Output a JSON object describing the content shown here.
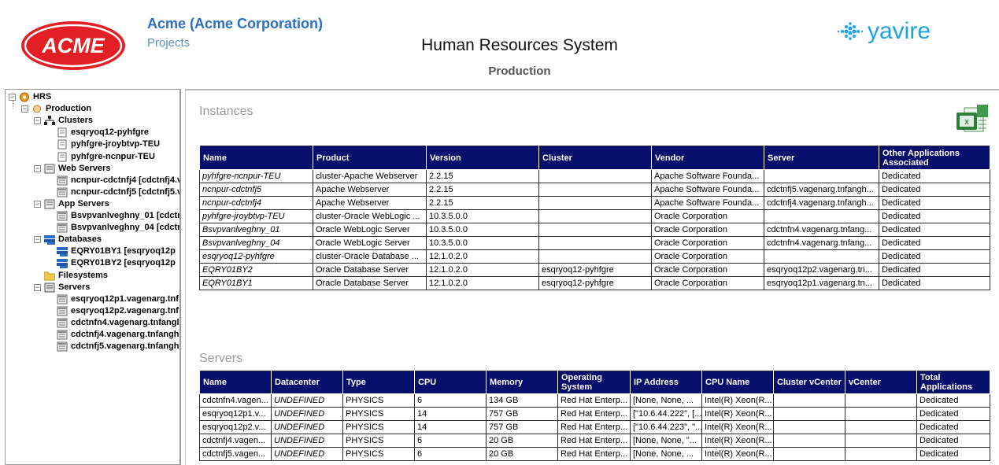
{
  "header": {
    "company": "Acme (Acme Corporation)",
    "projects_link": "Projects",
    "system_title": "Human Resources System",
    "environment": "Production",
    "acme_logo_text": "ACME",
    "yavire_logo_text": "yavire",
    "colors": {
      "acme_red": "#e31e24",
      "company_blue": "#2a6ec6",
      "yavire_blue": "#1aa3e8"
    }
  },
  "tree": {
    "root": "HRS",
    "environment": "Production",
    "groups": [
      {
        "label": "Clusters",
        "icon": "cluster-icon",
        "items": [
          "esqryoq12-pyhfgre",
          "pyhfgre-jroybtvp-TEU",
          "pyhfgre-ncnpur-TEU"
        ]
      },
      {
        "label": "Web Servers",
        "icon": "web-server-icon",
        "items": [
          "ncnpur-cdctnfj4 [cdctnfj4.v",
          "ncnpur-cdctnfj5 [cdctnfj5.v"
        ]
      },
      {
        "label": "App Servers",
        "icon": "app-server-icon",
        "items": [
          "Bsvpvanlveghny_01 [cdctn",
          "Bsvpvanlveghny_04 [cdctn"
        ]
      },
      {
        "label": "Databases",
        "icon": "database-icon",
        "items": [
          "EQRY01BY1 [esqryoq12p",
          "EQRY01BY2 [esqryoq12p"
        ]
      },
      {
        "label": "Filesystems",
        "icon": "folder-icon",
        "items": []
      },
      {
        "label": "Servers",
        "icon": "server-icon",
        "items": [
          "esqryoq12p1.vagenarg.tnf",
          "esqryoq12p2.vagenarg.tnf",
          "cdctnfn4.vagenarg.tnfangl",
          "cdctnfj4.vagenarg.tnfangh",
          "cdctnfj5.vagenarg.tnfangh"
        ]
      }
    ]
  },
  "instances": {
    "title": "Instances",
    "columns": [
      "Name",
      "Product",
      "Version",
      "Cluster",
      "Vendor",
      "Server",
      "Other Applications Associated"
    ],
    "rows": [
      [
        "pyhfgre-ncnpur-TEU",
        "cluster-Apache Webserver",
        "2.2.15",
        "",
        "Apache Software Founda...",
        "",
        "Dedicated"
      ],
      [
        "ncnpur-cdctnfj5",
        "Apache Webserver",
        "2.2.15",
        "",
        "Apache Software Founda...",
        "cdctnfj5.vagenarg.tnfangh...",
        "Dedicated"
      ],
      [
        "ncnpur-cdctnfj4",
        "Apache Webserver",
        "2.2.15",
        "",
        "Apache Software Founda...",
        "cdctnfj4.vagenarg.tnfangh...",
        "Dedicated"
      ],
      [
        "pyhfgre-jroybtvp-TEU",
        "cluster-Oracle WebLogic ...",
        "10.3.5.0.0",
        "",
        "Oracle Corporation",
        "",
        "Dedicated"
      ],
      [
        "Bsvpvanlveghny_01",
        "Oracle WebLogic Server",
        "10.3.5.0.0",
        "",
        "Oracle Corporation",
        "cdctnfn4.vagenarg.tnfang...",
        "Dedicated"
      ],
      [
        "Bsvpvanlveghny_04",
        "Oracle WebLogic Server",
        "10.3.5.0.0",
        "",
        "Oracle Corporation",
        "cdctnfn4.vagenarg.tnfang...",
        "Dedicated"
      ],
      [
        "esqryoq12-pyhfgre",
        "cluster-Oracle Database ...",
        "12.1.0.2.0",
        "",
        "Oracle Corporation",
        "",
        "Dedicated"
      ],
      [
        "EQRY01BY2",
        "Oracle Database Server",
        "12.1.0.2.0",
        "esqryoq12-pyhfgre",
        "Oracle Corporation",
        "esqryoq12p2.vagenarg.tn...",
        "Dedicated"
      ],
      [
        "EQRY01BY1",
        "Oracle Database Server",
        "12.1.0.2.0",
        "esqryoq12-pyhfgre",
        "Oracle Corporation",
        "esqryoq12p1.vagenarg.tn...",
        "Dedicated"
      ]
    ]
  },
  "servers": {
    "title": "Servers",
    "columns": [
      "Name",
      "Datacenter",
      "Type",
      "CPU",
      "Memory",
      "Operating System",
      "IP Address",
      "CPU Name",
      "Cluster vCenter",
      "vCenter",
      "Total Applications"
    ],
    "rows": [
      [
        "cdctnfn4.vagen...",
        "UNDEFINED",
        "PHYSICS",
        "6",
        "134 GB",
        "Red Hat Enterp...",
        "[None, None, ...",
        "Intel(R) Xeon(R...",
        "",
        "",
        "Dedicated"
      ],
      [
        "esqryoq12p1.v...",
        "UNDEFINED",
        "PHYSICS",
        "14",
        "757 GB",
        "Red Hat Enterp...",
        "[\"10.6.44.222\", [...",
        "Intel(R) Xeon(R...",
        "",
        "",
        "Dedicated"
      ],
      [
        "esqryoq12p2.v...",
        "UNDEFINED",
        "PHYSICS",
        "14",
        "757 GB",
        "Red Hat Enterp...",
        "[\"10.6.44.223\", \"...",
        "Intel(R) Xeon(R...",
        "",
        "",
        "Dedicated"
      ],
      [
        "cdctnfj4.vagen...",
        "UNDEFINED",
        "PHYSICS",
        "6",
        "20 GB",
        "Red Hat Enterp...",
        "[None, None, \"...",
        "Intel(R) Xeon(R...",
        "",
        "",
        "Dedicated"
      ],
      [
        "cdctnfj5.vagen...",
        "UNDEFINED",
        "PHYSICS",
        "6",
        "20 GB",
        "Red Hat Enterp...",
        "[None, None, ...",
        "Intel(R) Xeon(R...",
        "",
        "",
        "Dedicated"
      ]
    ]
  }
}
